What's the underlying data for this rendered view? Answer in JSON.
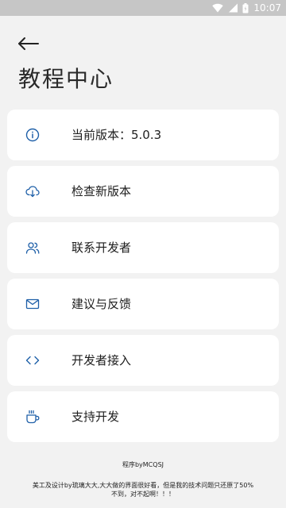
{
  "status_bar": {
    "time": "10:07",
    "battery_level": "",
    "icons": [
      "wifi-icon",
      "signal-icon",
      "battery-icon"
    ],
    "background_color": "#c6c6c6"
  },
  "header": {
    "back_icon": "arrow-left-icon",
    "title": "教程中心"
  },
  "menu": {
    "items": [
      {
        "icon": "info-icon",
        "label": "当前版本：5.0.3"
      },
      {
        "icon": "cloud-download-icon",
        "label": "检查新版本"
      },
      {
        "icon": "users-icon",
        "label": "联系开发者"
      },
      {
        "icon": "mail-icon",
        "label": "建议与反馈"
      },
      {
        "icon": "code-icon",
        "label": "开发者接入"
      },
      {
        "icon": "coffee-icon",
        "label": "支持开发"
      }
    ],
    "icon_color": "#1e5fa8"
  },
  "footer": {
    "author": "程序byMCQSJ",
    "note": "美工及设计by琉璃大大,大大做的界面很好看，但是我的技术问题只还原了50%不到，对不起啊！！！"
  }
}
